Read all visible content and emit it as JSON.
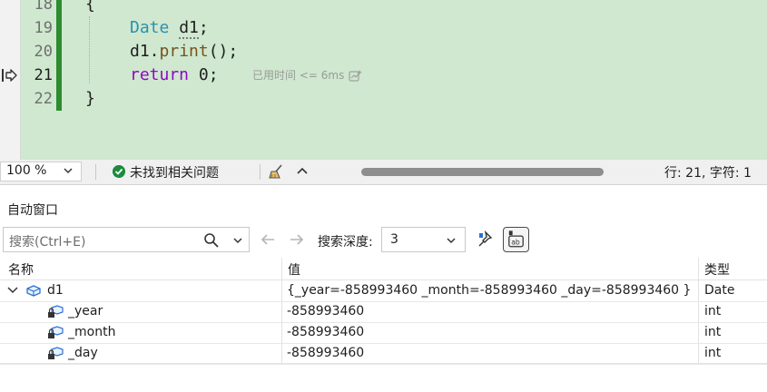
{
  "editor": {
    "lines": [
      {
        "number": "18",
        "code": "{"
      },
      {
        "number": "19",
        "type": "Date",
        "var": "d1",
        "end": ";"
      },
      {
        "number": "20",
        "obj": "d1.",
        "fn": "print",
        "end": "();"
      },
      {
        "number": "21",
        "kw": "return",
        "rest": " 0;"
      },
      {
        "number": "22",
        "code": "}"
      }
    ],
    "perf_tip": "已用时间 <= 6ms"
  },
  "status_bar": {
    "zoom": "100 %",
    "issues": "未找到相关问题",
    "cursor_position": "行: 21, 字符: 1"
  },
  "autos": {
    "title": "自动窗口",
    "search_placeholder": "搜索(Ctrl+E)",
    "depth_label": "搜索深度:",
    "depth_value": "3",
    "columns": {
      "name": "名称",
      "value": "值",
      "type": "类型"
    },
    "rows": [
      {
        "name": "d1",
        "value": "{_year=-858993460 _month=-858993460 _day=-858993460 }",
        "type": "Date"
      },
      {
        "name": "_year",
        "value": "-858993460",
        "type": "int"
      },
      {
        "name": "_month",
        "value": "-858993460",
        "type": "int"
      },
      {
        "name": "_day",
        "value": "-858993460",
        "type": "int"
      }
    ]
  },
  "colors": {
    "editor_bg": "#cfe8cf",
    "keyword": "#8f08c4",
    "type": "#2b91af",
    "change_bar": "#2e8b2e",
    "ok_status": "#1a8c3c"
  },
  "icons": [
    "execution-arrow-icon",
    "perf-tip-icon",
    "check-circle-icon",
    "broom-icon",
    "chevron-up-icon",
    "search-icon",
    "arrow-left-icon",
    "arrow-right-icon",
    "pin-icon",
    "hex-display-icon",
    "object-icon",
    "private-field-icon"
  ]
}
